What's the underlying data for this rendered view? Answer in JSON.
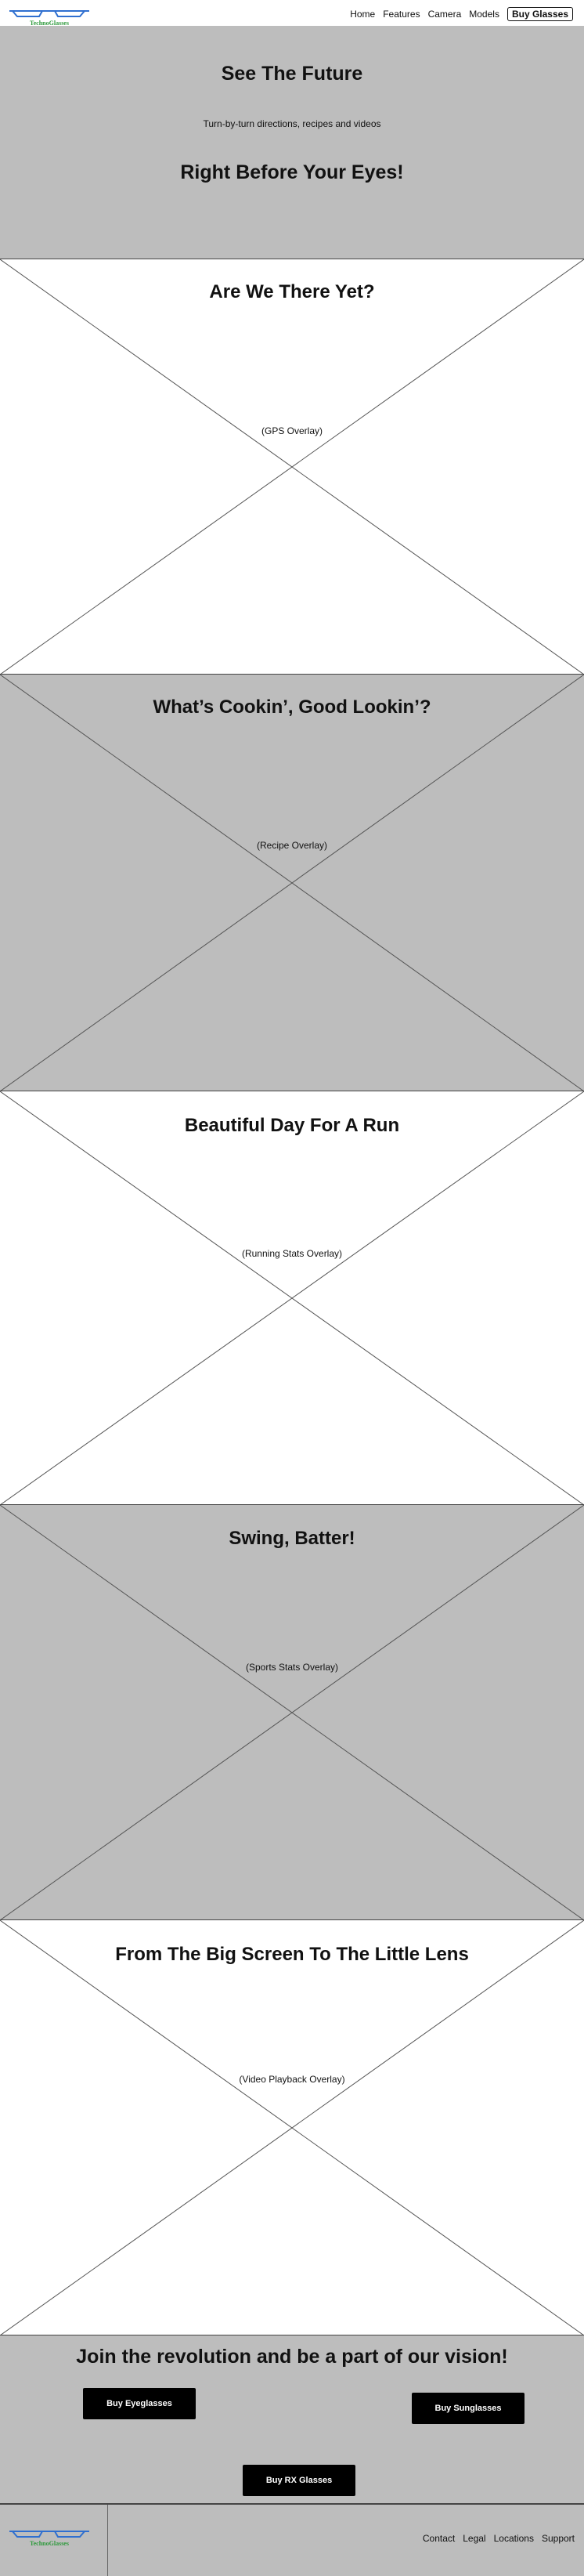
{
  "header": {
    "logo_text": "TechnoGlasses",
    "nav": [
      "Home",
      "Features",
      "Camera",
      "Models"
    ],
    "buy_label": "Buy Glasses"
  },
  "hero": {
    "title": "See The Future",
    "subtitle": "Turn-by-turn directions, recipes and videos",
    "tagline": "Right Before Your Eyes!"
  },
  "sections": [
    {
      "title": "Are We There Yet?",
      "caption": "(GPS Overlay)"
    },
    {
      "title": "What’s Cookin’, Good Lookin’?",
      "caption": "(Recipe Overlay)"
    },
    {
      "title": "Beautiful Day For A Run",
      "caption": "(Running Stats Overlay)"
    },
    {
      "title": "Swing, Batter!",
      "caption": "(Sports Stats Overlay)"
    },
    {
      "title": "From The Big Screen To The Little Lens",
      "caption": "(Video Playback Overlay)"
    }
  ],
  "cta": {
    "title": "Join the revolution and be a part of our vision!",
    "eyeglasses": "Buy Eyeglasses",
    "sunglasses": "Buy Sunglasses",
    "rx": "Buy RX Glasses"
  },
  "footer": {
    "links": [
      "Contact",
      "Legal",
      "Locations",
      "Support"
    ]
  },
  "colors": {
    "gray": "#bdbdbd",
    "logo_blue": "#2f6fd0",
    "logo_green": "#2f9a3d"
  }
}
